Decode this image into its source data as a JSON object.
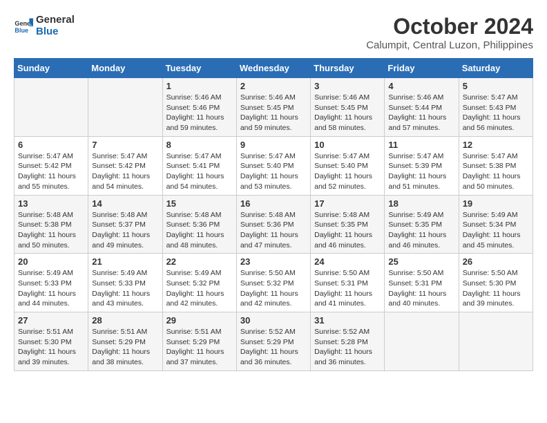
{
  "header": {
    "logo_general": "General",
    "logo_blue": "Blue",
    "month_year": "October 2024",
    "location": "Calumpit, Central Luzon, Philippines"
  },
  "days_of_week": [
    "Sunday",
    "Monday",
    "Tuesday",
    "Wednesday",
    "Thursday",
    "Friday",
    "Saturday"
  ],
  "weeks": [
    [
      {
        "day": "",
        "info": ""
      },
      {
        "day": "",
        "info": ""
      },
      {
        "day": "1",
        "info": "Sunrise: 5:46 AM\nSunset: 5:46 PM\nDaylight: 11 hours and 59 minutes."
      },
      {
        "day": "2",
        "info": "Sunrise: 5:46 AM\nSunset: 5:45 PM\nDaylight: 11 hours and 59 minutes."
      },
      {
        "day": "3",
        "info": "Sunrise: 5:46 AM\nSunset: 5:45 PM\nDaylight: 11 hours and 58 minutes."
      },
      {
        "day": "4",
        "info": "Sunrise: 5:46 AM\nSunset: 5:44 PM\nDaylight: 11 hours and 57 minutes."
      },
      {
        "day": "5",
        "info": "Sunrise: 5:47 AM\nSunset: 5:43 PM\nDaylight: 11 hours and 56 minutes."
      }
    ],
    [
      {
        "day": "6",
        "info": "Sunrise: 5:47 AM\nSunset: 5:42 PM\nDaylight: 11 hours and 55 minutes."
      },
      {
        "day": "7",
        "info": "Sunrise: 5:47 AM\nSunset: 5:42 PM\nDaylight: 11 hours and 54 minutes."
      },
      {
        "day": "8",
        "info": "Sunrise: 5:47 AM\nSunset: 5:41 PM\nDaylight: 11 hours and 54 minutes."
      },
      {
        "day": "9",
        "info": "Sunrise: 5:47 AM\nSunset: 5:40 PM\nDaylight: 11 hours and 53 minutes."
      },
      {
        "day": "10",
        "info": "Sunrise: 5:47 AM\nSunset: 5:40 PM\nDaylight: 11 hours and 52 minutes."
      },
      {
        "day": "11",
        "info": "Sunrise: 5:47 AM\nSunset: 5:39 PM\nDaylight: 11 hours and 51 minutes."
      },
      {
        "day": "12",
        "info": "Sunrise: 5:47 AM\nSunset: 5:38 PM\nDaylight: 11 hours and 50 minutes."
      }
    ],
    [
      {
        "day": "13",
        "info": "Sunrise: 5:48 AM\nSunset: 5:38 PM\nDaylight: 11 hours and 50 minutes."
      },
      {
        "day": "14",
        "info": "Sunrise: 5:48 AM\nSunset: 5:37 PM\nDaylight: 11 hours and 49 minutes."
      },
      {
        "day": "15",
        "info": "Sunrise: 5:48 AM\nSunset: 5:36 PM\nDaylight: 11 hours and 48 minutes."
      },
      {
        "day": "16",
        "info": "Sunrise: 5:48 AM\nSunset: 5:36 PM\nDaylight: 11 hours and 47 minutes."
      },
      {
        "day": "17",
        "info": "Sunrise: 5:48 AM\nSunset: 5:35 PM\nDaylight: 11 hours and 46 minutes."
      },
      {
        "day": "18",
        "info": "Sunrise: 5:49 AM\nSunset: 5:35 PM\nDaylight: 11 hours and 46 minutes."
      },
      {
        "day": "19",
        "info": "Sunrise: 5:49 AM\nSunset: 5:34 PM\nDaylight: 11 hours and 45 minutes."
      }
    ],
    [
      {
        "day": "20",
        "info": "Sunrise: 5:49 AM\nSunset: 5:33 PM\nDaylight: 11 hours and 44 minutes."
      },
      {
        "day": "21",
        "info": "Sunrise: 5:49 AM\nSunset: 5:33 PM\nDaylight: 11 hours and 43 minutes."
      },
      {
        "day": "22",
        "info": "Sunrise: 5:49 AM\nSunset: 5:32 PM\nDaylight: 11 hours and 42 minutes."
      },
      {
        "day": "23",
        "info": "Sunrise: 5:50 AM\nSunset: 5:32 PM\nDaylight: 11 hours and 42 minutes."
      },
      {
        "day": "24",
        "info": "Sunrise: 5:50 AM\nSunset: 5:31 PM\nDaylight: 11 hours and 41 minutes."
      },
      {
        "day": "25",
        "info": "Sunrise: 5:50 AM\nSunset: 5:31 PM\nDaylight: 11 hours and 40 minutes."
      },
      {
        "day": "26",
        "info": "Sunrise: 5:50 AM\nSunset: 5:30 PM\nDaylight: 11 hours and 39 minutes."
      }
    ],
    [
      {
        "day": "27",
        "info": "Sunrise: 5:51 AM\nSunset: 5:30 PM\nDaylight: 11 hours and 39 minutes."
      },
      {
        "day": "28",
        "info": "Sunrise: 5:51 AM\nSunset: 5:29 PM\nDaylight: 11 hours and 38 minutes."
      },
      {
        "day": "29",
        "info": "Sunrise: 5:51 AM\nSunset: 5:29 PM\nDaylight: 11 hours and 37 minutes."
      },
      {
        "day": "30",
        "info": "Sunrise: 5:52 AM\nSunset: 5:29 PM\nDaylight: 11 hours and 36 minutes."
      },
      {
        "day": "31",
        "info": "Sunrise: 5:52 AM\nSunset: 5:28 PM\nDaylight: 11 hours and 36 minutes."
      },
      {
        "day": "",
        "info": ""
      },
      {
        "day": "",
        "info": ""
      }
    ]
  ]
}
